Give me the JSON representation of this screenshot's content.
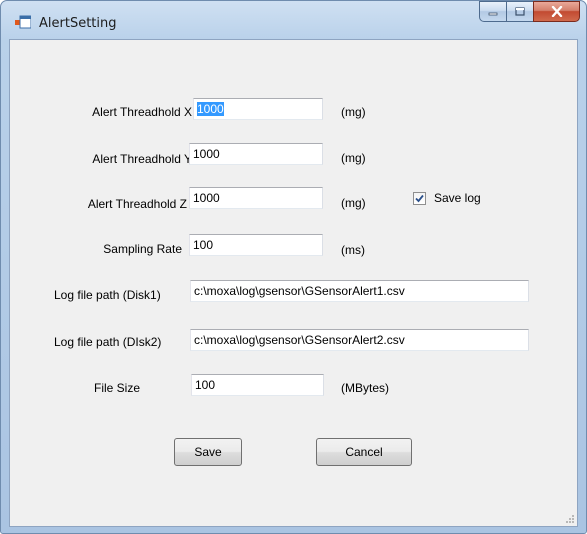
{
  "window": {
    "title": "AlertSetting"
  },
  "fields": [
    {
      "label": "Alert Threadhold X",
      "value": "1000",
      "unit": "(mg)"
    },
    {
      "label": "Alert Threadhold Y",
      "value": "1000",
      "unit": "(mg)"
    },
    {
      "label": "Alert Threadhold Z",
      "value": "1000",
      "unit": "(mg)"
    },
    {
      "label": "Sampling Rate",
      "value": "100",
      "unit": "(ms)"
    },
    {
      "label": "Log file path (Disk1)",
      "value": "c:\\moxa\\log\\gsensor\\GSensorAlert1.csv"
    },
    {
      "label": "Log file path (DIsk2)",
      "value": "c:\\moxa\\log\\gsensor\\GSensorAlert2.csv"
    },
    {
      "label": "File Size",
      "value": "100",
      "unit": "(MBytes)"
    }
  ],
  "save_log": {
    "label": "Save log",
    "checked": true
  },
  "buttons": {
    "save": "Save",
    "cancel": "Cancel"
  },
  "colors": {
    "selection": "#3399ff",
    "dialog_bg": "#f0f0f0",
    "close_button": "#c24a31"
  }
}
